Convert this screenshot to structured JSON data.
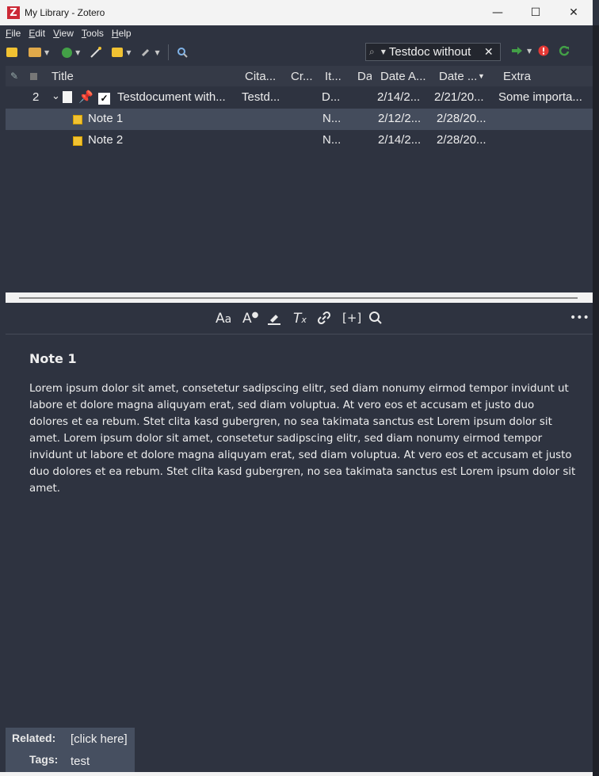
{
  "window": {
    "title": "My Library - Zotero",
    "logo": "Z",
    "buttons": {
      "minimize": "—",
      "maximize": "☐",
      "close": "✕"
    }
  },
  "menubar": [
    {
      "underline": "F",
      "rest": "ile"
    },
    {
      "underline": "E",
      "rest": "dit"
    },
    {
      "underline": "V",
      "rest": "iew"
    },
    {
      "underline": "T",
      "rest": "ools"
    },
    {
      "underline": "H",
      "rest": "elp"
    }
  ],
  "toolbar": {
    "icons": [
      "new-collection-icon",
      "new-library-icon",
      "new-item-icon",
      "magic-wand-icon",
      "new-note-icon",
      "attachment-icon",
      "locate-icon"
    ],
    "search": {
      "value": "Testdoc without",
      "mode_icon": "search-icon"
    },
    "right_icons": [
      "sync-forward-icon",
      "error-icon",
      "sync-icon"
    ]
  },
  "table": {
    "columns": [
      "Title",
      "Cita...",
      "Cr...",
      "It...",
      "Da",
      "Date A...",
      "Date ...",
      "Extra"
    ],
    "rows": [
      {
        "num": "2",
        "title": "Testdocument with...",
        "citation": "Testd...",
        "item_type": "D...",
        "date_added": "2/14/2...",
        "date_modified": "2/21/20...",
        "extra": "Some importa..."
      },
      {
        "num": "",
        "title": "Note 1",
        "citation": "",
        "item_type": "N...",
        "date_added": "2/12/2...",
        "date_modified": "2/28/20...",
        "extra": ""
      },
      {
        "num": "",
        "title": "Note 2",
        "citation": "",
        "item_type": "N...",
        "date_added": "2/14/2...",
        "date_modified": "2/28/20...",
        "extra": ""
      }
    ]
  },
  "editor": {
    "toolbar": [
      "Aa",
      "A",
      "highlight",
      "Tx",
      "link",
      "[+]",
      "search",
      "more"
    ],
    "note_title": "Note 1",
    "note_text": "Lorem ipsum dolor sit amet, consetetur sadipscing elitr, sed diam nonumy eirmod tempor invidunt ut labore et dolore magna aliquyam erat, sed diam voluptua. At vero eos et accusam et justo duo dolores et ea rebum. Stet clita kasd gubergren, no sea takimata sanctus est Lorem ipsum dolor sit amet. Lorem ipsum dolor sit amet, consetetur sadipscing elitr, sed diam nonumy eirmod tempor invidunt ut labore et dolore magna aliquyam erat, sed diam voluptua. At vero eos et accusam et justo duo dolores et ea rebum. Stet clita kasd gubergren, no sea takimata sanctus est Lorem ipsum dolor sit amet."
  },
  "footer": {
    "related_label": "Related:",
    "related_value": "[click here]",
    "tags_label": "Tags:",
    "tags_value": "test"
  },
  "colors": {
    "background": "#2e3340",
    "selected_row": "#444c5c",
    "accent_red": "#cc2936"
  }
}
